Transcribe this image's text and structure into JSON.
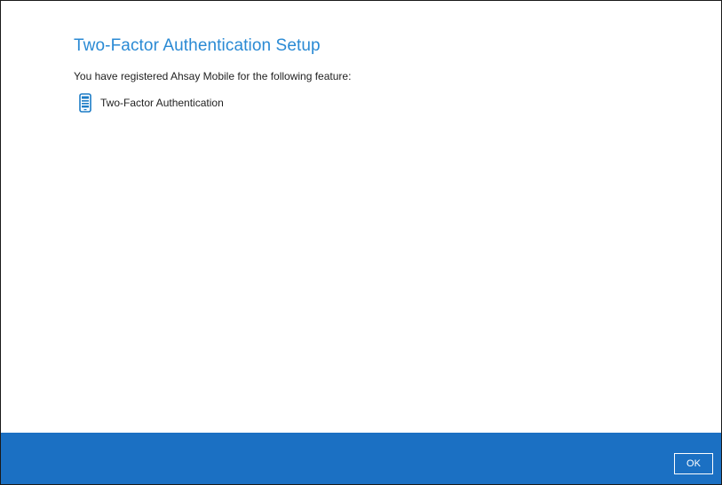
{
  "dialog": {
    "title": "Two-Factor Authentication Setup",
    "message": "You have registered Ahsay Mobile for the following feature:",
    "features": [
      {
        "label": "Two-Factor Authentication",
        "icon": "mobile-phone-icon"
      }
    ]
  },
  "footer": {
    "ok_label": "OK"
  },
  "colors": {
    "title": "#2a8ad4",
    "footer_bar": "#1b70c3",
    "icon": "#1c7cc6"
  }
}
